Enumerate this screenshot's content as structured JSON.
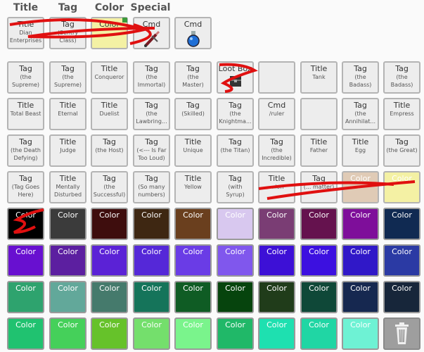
{
  "headers": [
    "Title",
    "Tag",
    "Color",
    "Special"
  ],
  "top_items": [
    {
      "kind": "tile",
      "title": "Title",
      "sub": "Dian Enterprises",
      "bg": "#ededed"
    },
    {
      "kind": "tile",
      "title": "Tag",
      "sub": "(Sentry Class)",
      "bg": "#ededed"
    },
    {
      "kind": "tile",
      "title": "Color",
      "sub": "",
      "bg": "#f4f1a4"
    },
    {
      "kind": "tile",
      "title": "Cmd",
      "sub": "",
      "bg": "#ededed",
      "icon": "sword-icon"
    },
    {
      "kind": "tile",
      "title": "Cmd",
      "sub": "",
      "bg": "#ededed",
      "icon": "potion-icon"
    }
  ],
  "grid": [
    [
      {
        "title": "Tag",
        "sub": "(the Supreme)"
      },
      {
        "title": "Tag",
        "sub": "(the Supreme)"
      },
      {
        "title": "Title",
        "sub": "Conqueror"
      },
      {
        "title": "Tag",
        "sub": "(the Immortal)"
      },
      {
        "title": "Tag",
        "sub": "(the Master)"
      },
      {
        "title": "Loot Box",
        "sub": "",
        "icon": "lootbox-icon"
      },
      {
        "title": "",
        "sub": ""
      },
      {
        "title": "Title",
        "sub": "Tank"
      },
      {
        "title": "Tag",
        "sub": "(the Badass)"
      },
      {
        "title": "Tag",
        "sub": "(the Badass)"
      }
    ],
    [
      {
        "title": "Title",
        "sub": "Total Beast"
      },
      {
        "title": "Title",
        "sub": "Eternal"
      },
      {
        "title": "Title",
        "sub": "Duelist"
      },
      {
        "title": "Tag",
        "sub": "(the Lawbring..."
      },
      {
        "title": "Tag",
        "sub": "(Skilled)"
      },
      {
        "title": "Tag",
        "sub": "(the Knightma..."
      },
      {
        "title": "Cmd",
        "sub": "/ruler"
      },
      {
        "title": "",
        "sub": ""
      },
      {
        "title": "Tag",
        "sub": "(the Annihilat..."
      },
      {
        "title": "Title",
        "sub": "Empress"
      }
    ],
    [
      {
        "title": "Tag",
        "sub": "(the Death Defying)"
      },
      {
        "title": "Title",
        "sub": "Judge"
      },
      {
        "title": "Tag",
        "sub": "(the Host)"
      },
      {
        "title": "Tag",
        "sub": "(<--- Is Far Too Loud)"
      },
      {
        "title": "Title",
        "sub": "Unique"
      },
      {
        "title": "Tag",
        "sub": "(the Titan)"
      },
      {
        "title": "Tag",
        "sub": "(the Incredible)"
      },
      {
        "title": "Title",
        "sub": "Father"
      },
      {
        "title": "Title",
        "sub": "Egg"
      },
      {
        "title": "Tag",
        "sub": "(the Great)"
      }
    ],
    [
      {
        "title": "Tag",
        "sub": "(Tag Goes Here)"
      },
      {
        "title": "Title",
        "sub": "Mentally Disturbed"
      },
      {
        "title": "Tag",
        "sub": "(the Successful)"
      },
      {
        "title": "Tag",
        "sub": "(So many numbers)"
      },
      {
        "title": "Title",
        "sub": "Yellow"
      },
      {
        "title": "Tag",
        "sub": "(with Syrup)"
      },
      {
        "title": "Title",
        "sub": "...ion"
      },
      {
        "title": "Tag",
        "sub": "(... matter)"
      },
      {
        "title": "Color",
        "sub": "",
        "bg": "#e0cbb6",
        "color": true
      },
      {
        "title": "Color",
        "sub": "",
        "bg": "#f4f1a4",
        "color": true
      }
    ]
  ],
  "color_label": "Color",
  "color_rows": [
    [
      "#000000",
      "#3b3b3b",
      "#3e0d0d",
      "#3e2712",
      "#6a3f1e",
      "#d8c8ef",
      "#7a3d74",
      "#65124e",
      "#7e0e9a",
      "#102a52"
    ],
    [
      "#6810d0",
      "#5c1fa0",
      "#5b22d6",
      "#5528d8",
      "#6a3ce6",
      "#8057ed",
      "#3d10d6",
      "#3c10e0",
      "#3018c8",
      "#2b3aa4"
    ],
    [
      "#2ea36e",
      "#62a89a",
      "#457a6c",
      "#15745a",
      "#0f5c24",
      "#06440d",
      "#203c1a",
      "#0f4838",
      "#162850",
      "#17263a"
    ],
    [
      "#20c270",
      "#45d05a",
      "#66c22a",
      "#74df6c",
      "#7af48c",
      "#20b868",
      "#1ee0b0",
      "#20d6a4",
      "#6ef2d4",
      null
    ]
  ],
  "trash": {
    "icon": "trash-icon"
  }
}
